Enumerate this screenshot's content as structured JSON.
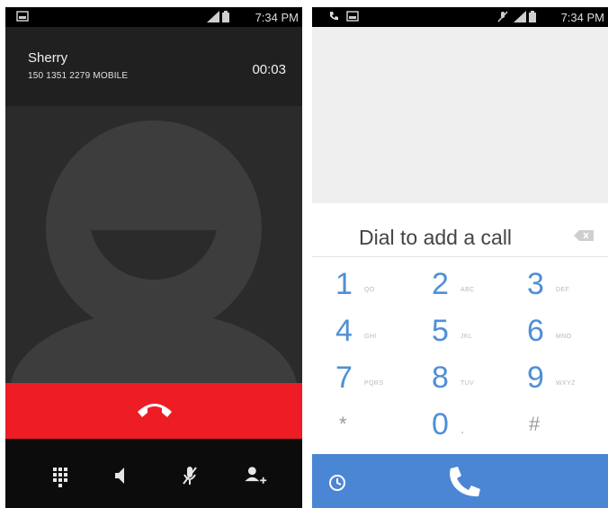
{
  "left_screen": {
    "status_bar": {
      "time": "7:34 PM",
      "icons": [
        "image-icon",
        "signal-icon",
        "battery-icon"
      ]
    },
    "caller": {
      "name": "Sherry",
      "number": "150 1351 2279  MOBILE"
    },
    "timer": "00:03",
    "end_call_color": "#ee1c24",
    "controls": [
      "dialpad-icon",
      "speaker-icon",
      "mute-icon",
      "add-call-icon"
    ]
  },
  "right_screen": {
    "status_bar": {
      "time": "7:34 PM",
      "icons": [
        "phone-icon",
        "image-icon",
        "mic-muted-icon",
        "signal-icon",
        "battery-icon"
      ]
    },
    "dial_prompt": "Dial to add a call",
    "keys": [
      {
        "digit": "1",
        "letters": "QO"
      },
      {
        "digit": "2",
        "letters": "ABC"
      },
      {
        "digit": "3",
        "letters": "DEF"
      },
      {
        "digit": "4",
        "letters": "GHI"
      },
      {
        "digit": "5",
        "letters": "JKL"
      },
      {
        "digit": "6",
        "letters": "MNO"
      },
      {
        "digit": "7",
        "letters": "PQRS"
      },
      {
        "digit": "8",
        "letters": "TUV"
      },
      {
        "digit": "9",
        "letters": "WXYZ"
      },
      {
        "digit": "*",
        "letters": ""
      },
      {
        "digit": "0",
        "letters": "."
      },
      {
        "digit": "#",
        "letters": ""
      }
    ],
    "accent_color": "#4b86d4",
    "bottom_icons": [
      "history-icon",
      "dial-icon"
    ]
  }
}
